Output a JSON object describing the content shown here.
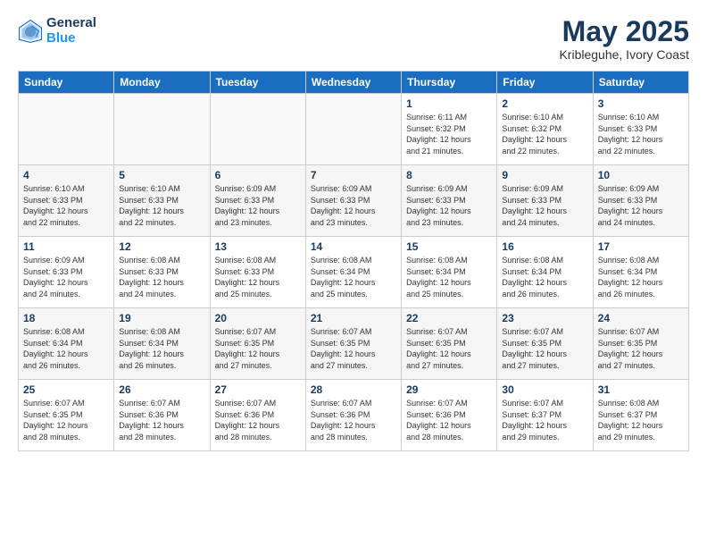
{
  "header": {
    "logo_line1": "General",
    "logo_line2": "Blue",
    "title": "May 2025",
    "subtitle": "Kribleguhe, Ivory Coast"
  },
  "weekdays": [
    "Sunday",
    "Monday",
    "Tuesday",
    "Wednesday",
    "Thursday",
    "Friday",
    "Saturday"
  ],
  "weeks": [
    [
      {
        "day": "",
        "detail": ""
      },
      {
        "day": "",
        "detail": ""
      },
      {
        "day": "",
        "detail": ""
      },
      {
        "day": "",
        "detail": ""
      },
      {
        "day": "1",
        "detail": "Sunrise: 6:11 AM\nSunset: 6:32 PM\nDaylight: 12 hours\nand 21 minutes."
      },
      {
        "day": "2",
        "detail": "Sunrise: 6:10 AM\nSunset: 6:32 PM\nDaylight: 12 hours\nand 22 minutes."
      },
      {
        "day": "3",
        "detail": "Sunrise: 6:10 AM\nSunset: 6:33 PM\nDaylight: 12 hours\nand 22 minutes."
      }
    ],
    [
      {
        "day": "4",
        "detail": "Sunrise: 6:10 AM\nSunset: 6:33 PM\nDaylight: 12 hours\nand 22 minutes."
      },
      {
        "day": "5",
        "detail": "Sunrise: 6:10 AM\nSunset: 6:33 PM\nDaylight: 12 hours\nand 22 minutes."
      },
      {
        "day": "6",
        "detail": "Sunrise: 6:09 AM\nSunset: 6:33 PM\nDaylight: 12 hours\nand 23 minutes."
      },
      {
        "day": "7",
        "detail": "Sunrise: 6:09 AM\nSunset: 6:33 PM\nDaylight: 12 hours\nand 23 minutes."
      },
      {
        "day": "8",
        "detail": "Sunrise: 6:09 AM\nSunset: 6:33 PM\nDaylight: 12 hours\nand 23 minutes."
      },
      {
        "day": "9",
        "detail": "Sunrise: 6:09 AM\nSunset: 6:33 PM\nDaylight: 12 hours\nand 24 minutes."
      },
      {
        "day": "10",
        "detail": "Sunrise: 6:09 AM\nSunset: 6:33 PM\nDaylight: 12 hours\nand 24 minutes."
      }
    ],
    [
      {
        "day": "11",
        "detail": "Sunrise: 6:09 AM\nSunset: 6:33 PM\nDaylight: 12 hours\nand 24 minutes."
      },
      {
        "day": "12",
        "detail": "Sunrise: 6:08 AM\nSunset: 6:33 PM\nDaylight: 12 hours\nand 24 minutes."
      },
      {
        "day": "13",
        "detail": "Sunrise: 6:08 AM\nSunset: 6:33 PM\nDaylight: 12 hours\nand 25 minutes."
      },
      {
        "day": "14",
        "detail": "Sunrise: 6:08 AM\nSunset: 6:34 PM\nDaylight: 12 hours\nand 25 minutes."
      },
      {
        "day": "15",
        "detail": "Sunrise: 6:08 AM\nSunset: 6:34 PM\nDaylight: 12 hours\nand 25 minutes."
      },
      {
        "day": "16",
        "detail": "Sunrise: 6:08 AM\nSunset: 6:34 PM\nDaylight: 12 hours\nand 26 minutes."
      },
      {
        "day": "17",
        "detail": "Sunrise: 6:08 AM\nSunset: 6:34 PM\nDaylight: 12 hours\nand 26 minutes."
      }
    ],
    [
      {
        "day": "18",
        "detail": "Sunrise: 6:08 AM\nSunset: 6:34 PM\nDaylight: 12 hours\nand 26 minutes."
      },
      {
        "day": "19",
        "detail": "Sunrise: 6:08 AM\nSunset: 6:34 PM\nDaylight: 12 hours\nand 26 minutes."
      },
      {
        "day": "20",
        "detail": "Sunrise: 6:07 AM\nSunset: 6:35 PM\nDaylight: 12 hours\nand 27 minutes."
      },
      {
        "day": "21",
        "detail": "Sunrise: 6:07 AM\nSunset: 6:35 PM\nDaylight: 12 hours\nand 27 minutes."
      },
      {
        "day": "22",
        "detail": "Sunrise: 6:07 AM\nSunset: 6:35 PM\nDaylight: 12 hours\nand 27 minutes."
      },
      {
        "day": "23",
        "detail": "Sunrise: 6:07 AM\nSunset: 6:35 PM\nDaylight: 12 hours\nand 27 minutes."
      },
      {
        "day": "24",
        "detail": "Sunrise: 6:07 AM\nSunset: 6:35 PM\nDaylight: 12 hours\nand 27 minutes."
      }
    ],
    [
      {
        "day": "25",
        "detail": "Sunrise: 6:07 AM\nSunset: 6:35 PM\nDaylight: 12 hours\nand 28 minutes."
      },
      {
        "day": "26",
        "detail": "Sunrise: 6:07 AM\nSunset: 6:36 PM\nDaylight: 12 hours\nand 28 minutes."
      },
      {
        "day": "27",
        "detail": "Sunrise: 6:07 AM\nSunset: 6:36 PM\nDaylight: 12 hours\nand 28 minutes."
      },
      {
        "day": "28",
        "detail": "Sunrise: 6:07 AM\nSunset: 6:36 PM\nDaylight: 12 hours\nand 28 minutes."
      },
      {
        "day": "29",
        "detail": "Sunrise: 6:07 AM\nSunset: 6:36 PM\nDaylight: 12 hours\nand 28 minutes."
      },
      {
        "day": "30",
        "detail": "Sunrise: 6:07 AM\nSunset: 6:37 PM\nDaylight: 12 hours\nand 29 minutes."
      },
      {
        "day": "31",
        "detail": "Sunrise: 6:08 AM\nSunset: 6:37 PM\nDaylight: 12 hours\nand 29 minutes."
      }
    ]
  ]
}
